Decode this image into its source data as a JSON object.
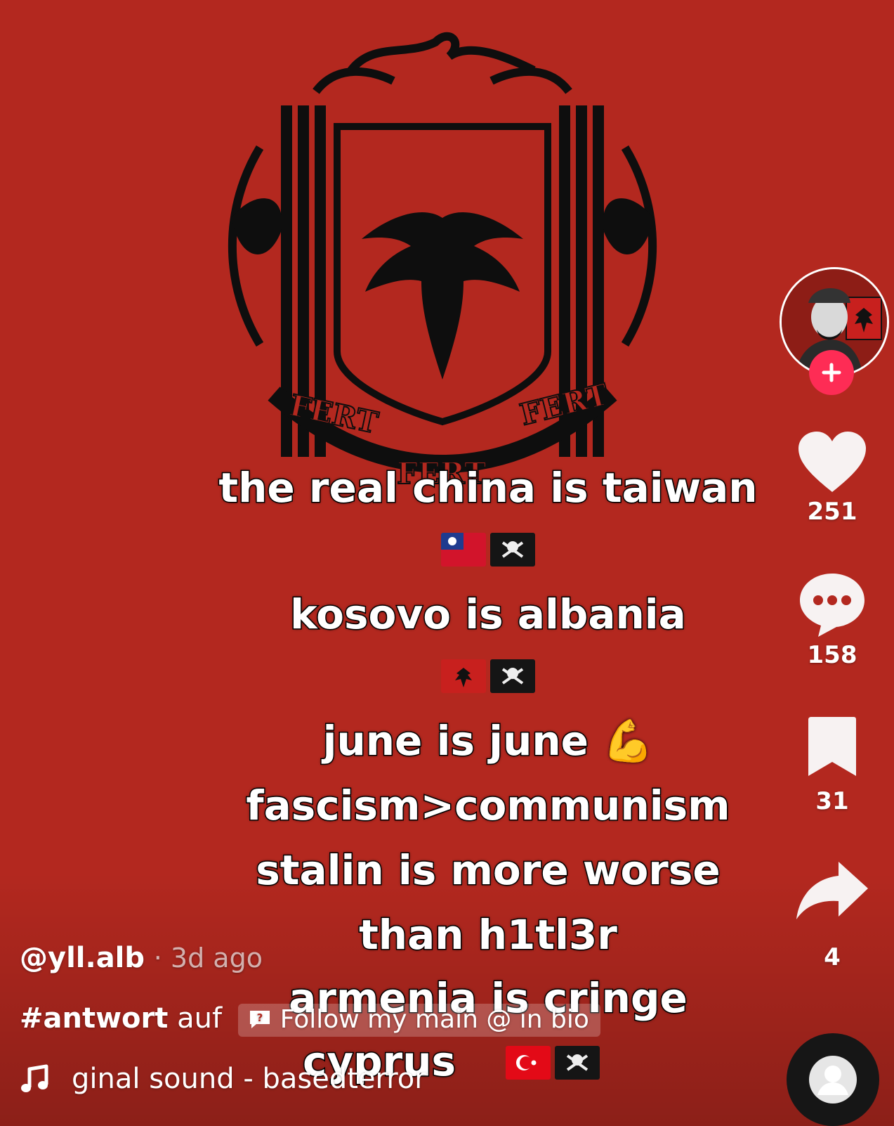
{
  "captions": {
    "line1": "the real china is taiwan",
    "line2": "kosovo is albania",
    "line3": "june is june 💪",
    "line4": "fascism>communism",
    "line5": "stalin is more worse",
    "line6": "than h1tl3r",
    "line7": "armenia is cringe",
    "line8": "cyprus"
  },
  "emblem": {
    "motto": "FERT"
  },
  "actions": {
    "likes": "251",
    "comments": "158",
    "saves": "31",
    "shares": "4"
  },
  "post": {
    "username": "@yll.alb",
    "time": "· 3d ago",
    "hashtag": "#antwort",
    "hashtag_suffix": "auf",
    "reply_chip": "Follow my main @ in bio",
    "sound": "ginal sound - basedterror"
  },
  "icons": {
    "heart": "heart-icon",
    "comment": "comment-icon",
    "bookmark": "bookmark-icon",
    "share": "share-icon",
    "music": "music-note-icon",
    "plus": "plus-icon"
  },
  "colors": {
    "background": "#b3281f",
    "follow": "#fe2c55",
    "emblem": "#0e0e0e"
  }
}
